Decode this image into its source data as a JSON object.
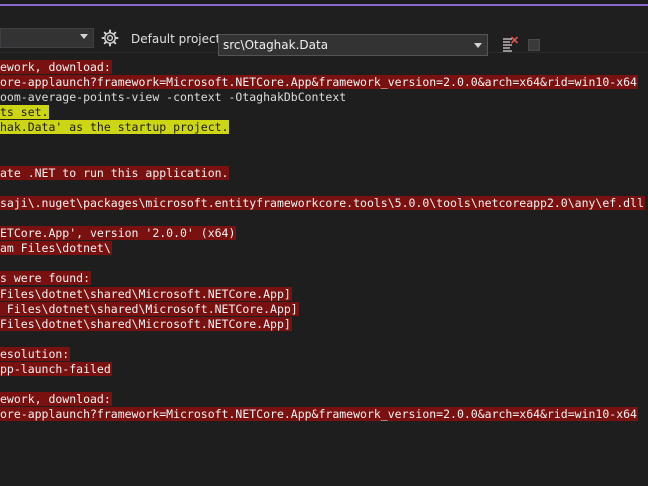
{
  "toolbar": {
    "default_project_label": "Default project:",
    "default_project_value": "src\\Otaghak.Data"
  },
  "console": {
    "lines": [
      {
        "text": "ework, download:",
        "style": "err"
      },
      {
        "text": "ore-applaunch?framework=Microsoft.NETCore.App&framework_version=2.0.0&arch=x64&rid=win10-x64",
        "style": "err"
      },
      {
        "text": "oom-average-points-view -context -OtaghakDbContext",
        "style": "plain"
      },
      {
        "text": "ts set.",
        "style": "warn"
      },
      {
        "text": "hak.Data' as the startup project.",
        "style": "warn"
      },
      {
        "text": "",
        "style": "plain"
      },
      {
        "text": "",
        "style": "plain"
      },
      {
        "text": "ate .NET to run this application.",
        "style": "err"
      },
      {
        "text": "",
        "style": "plain"
      },
      {
        "text": "saji\\.nuget\\packages\\microsoft.entityframeworkcore.tools\\5.0.0\\tools\\netcoreapp2.0\\any\\ef.dll",
        "style": "err"
      },
      {
        "text": "",
        "style": "plain"
      },
      {
        "text": "ETCore.App', version '2.0.0' (x64)",
        "style": "err"
      },
      {
        "text": "am Files\\dotnet\\",
        "style": "err"
      },
      {
        "text": "",
        "style": "plain"
      },
      {
        "text": "s were found:",
        "style": "err"
      },
      {
        "text": "Files\\dotnet\\shared\\Microsoft.NETCore.App]",
        "style": "err"
      },
      {
        "text": " Files\\dotnet\\shared\\Microsoft.NETCore.App]",
        "style": "err"
      },
      {
        "text": "Files\\dotnet\\shared\\Microsoft.NETCore.App]",
        "style": "err"
      },
      {
        "text": "",
        "style": "plain"
      },
      {
        "text": "esolution:",
        "style": "err"
      },
      {
        "text": "pp-launch-failed",
        "style": "err"
      },
      {
        "text": "",
        "style": "plain"
      },
      {
        "text": "ework, download:",
        "style": "err"
      },
      {
        "text": "ore-applaunch?framework=Microsoft.NETCore.App&framework_version=2.0.0&arch=x64&rid=win10-x64",
        "style": "err"
      }
    ]
  },
  "icons": {
    "settings": "gear-icon",
    "clear": "clear-console-icon",
    "stop": "stop-icon"
  }
}
